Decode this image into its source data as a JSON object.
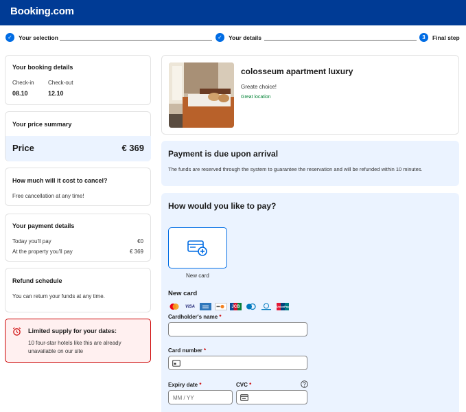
{
  "header": {
    "logo": "Booking.com"
  },
  "steps": [
    {
      "label": "Your selection",
      "marker": "✓"
    },
    {
      "label": "Your details",
      "marker": "✓"
    },
    {
      "label": "Final step",
      "marker": "3"
    }
  ],
  "booking_details": {
    "title": "Your booking details",
    "checkin_label": "Check-in",
    "checkin_value": "08.10",
    "checkout_label": "Check-out",
    "checkout_value": "12.10"
  },
  "price_summary": {
    "title": "Your price summary",
    "price_label": "Price",
    "price_value": "€ 369"
  },
  "cancel": {
    "title": "How much will it cost to cancel?",
    "text": "Free cancellation at any time!"
  },
  "payment_details": {
    "title": "Your payment details",
    "today_label": "Today you'll pay",
    "today_value": "€0",
    "property_label": "At the property you'll pay",
    "property_value": "€ 369"
  },
  "refund": {
    "title": "Refund schedule",
    "text": "You can return your funds at any time."
  },
  "supply": {
    "title": "Limited supply for your dates:",
    "line1": "10 four-star hotels like this are already",
    "line2": "unavailable on our site"
  },
  "hotel": {
    "name": "colosseum apartment luxury",
    "subtitle": "Greate choice!",
    "location": "Great location"
  },
  "arrival": {
    "title": "Payment is due upon arrival",
    "text": "The funds are reserved through the system to guarantee the reservation and will be refunded within 10 minutes."
  },
  "pay": {
    "title": "How would you like to pay?",
    "tile_label": "New card",
    "new_card_title": "New card",
    "brands": [
      "VISA",
      "JCB",
      "UnionPay"
    ],
    "cardholder_label": "Cardholder's name",
    "card_number_label": "Card number",
    "expiry_label": "Expiry date",
    "expiry_placeholder": "MM / YY",
    "cvc_label": "CVC",
    "required_mark": "*"
  },
  "colors": {
    "brand_blue": "#003b95",
    "action_blue": "#006ce4",
    "panel_blue": "#ebf3ff",
    "success_green": "#008234",
    "alert_red": "#cc0000"
  }
}
